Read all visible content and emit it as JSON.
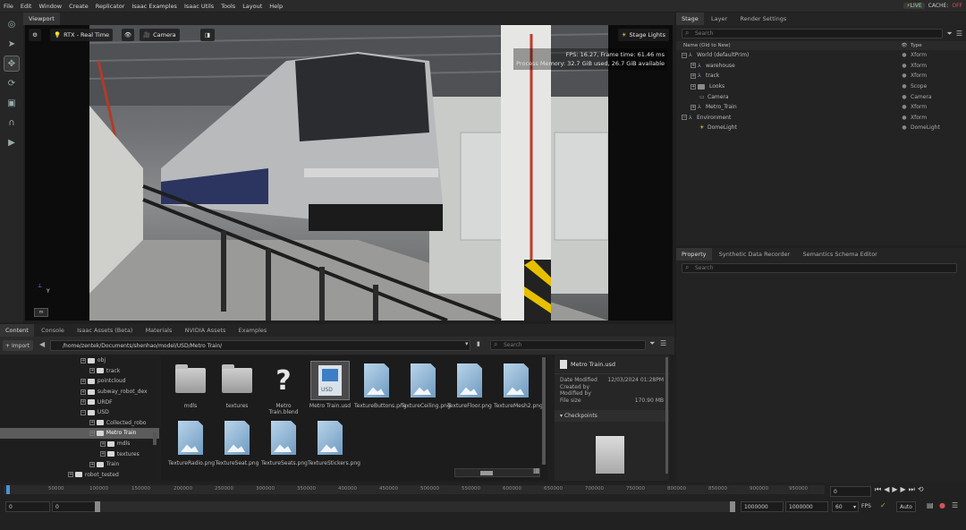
{
  "menubar": {
    "items": [
      "File",
      "Edit",
      "Window",
      "Create",
      "Replicator",
      "Isaac Examples",
      "Isaac Utils",
      "Tools",
      "Layout",
      "Help"
    ],
    "live_label": "LIVE",
    "cache_label": "CACHE:",
    "cache_state": "OFF"
  },
  "viewport": {
    "tab": "Viewport",
    "renderer": "RTX - Real Time",
    "camera": "Camera",
    "stage_lights": "Stage Lights",
    "fps_line": "FPS: 16.27, Frame time: 61.46 ms",
    "memory_line": "Process Memory: 32.7 GiB used, 26.7 GiB available",
    "axis_label": "Y"
  },
  "stage": {
    "tabs": [
      "Stage",
      "Layer",
      "Render Settings"
    ],
    "search_placeholder": "Search",
    "col_name": "Name (Old to New)",
    "col_type": "Type",
    "rows": [
      {
        "name": "World (defaultPrim)",
        "type": "Xform"
      },
      {
        "name": "warehouse",
        "type": "Xform"
      },
      {
        "name": "track",
        "type": "Xform"
      },
      {
        "name": "Looks",
        "type": "Scope"
      },
      {
        "name": "Camera",
        "type": "Camera"
      },
      {
        "name": "Metro_Train",
        "type": "Xform"
      },
      {
        "name": "Environment",
        "type": "Xform"
      },
      {
        "name": "DomeLight",
        "type": "DomeLight"
      }
    ]
  },
  "property": {
    "tabs": [
      "Property",
      "Synthetic Data Recorder",
      "Semantics Schema Editor"
    ],
    "search_placeholder": "Search"
  },
  "content": {
    "tabs": [
      "Content",
      "Console",
      "Isaac Assets (Beta)",
      "Materials",
      "NVIDIA Assets",
      "Examples"
    ],
    "import_label": "Import",
    "path": "/home/zentek/Documents/shenhao/model/USD/Metro Train/",
    "search_placeholder": "Search",
    "tree": [
      {
        "label": "obj"
      },
      {
        "label": "track"
      },
      {
        "label": "pointcloud"
      },
      {
        "label": "subway_robot_dex"
      },
      {
        "label": "URDF"
      },
      {
        "label": "USD"
      },
      {
        "label": "Collected_robo"
      },
      {
        "label": "Metro Train"
      },
      {
        "label": "mdls"
      },
      {
        "label": "textures"
      },
      {
        "label": "Train"
      },
      {
        "label": "robot_tested"
      }
    ],
    "grid": [
      {
        "label": "mdls"
      },
      {
        "label": "textures"
      },
      {
        "label": "Metro Train.blend"
      },
      {
        "label": "Metro Train.usd"
      },
      {
        "label": "TextureButtons.png"
      },
      {
        "label": "TextureCeiling.png"
      },
      {
        "label": "TextureFloor.png"
      },
      {
        "label": "TextureMesh2.png"
      },
      {
        "label": "TextureRadio.png"
      },
      {
        "label": "TextureSeat.png"
      },
      {
        "label": "TextureSeats.png"
      },
      {
        "label": "TextureStickers.png"
      }
    ],
    "details": {
      "file_name": "Metro Train.usd",
      "date_modified_label": "Date Modified",
      "date_modified": "12/03/2024 01:28PM",
      "created_by_label": "Created by",
      "modified_by_label": "Modified by",
      "file_size_label": "File size",
      "file_size": "170.90 MB",
      "checkpoints": "Checkpoints"
    }
  },
  "timeline": {
    "ticks": [
      "50000",
      "100000",
      "150000",
      "200000",
      "250000",
      "300000",
      "350000",
      "400000",
      "450000",
      "500000",
      "550000",
      "600000",
      "650000",
      "700000",
      "750000",
      "800000",
      "850000",
      "900000",
      "950000"
    ],
    "current_frame": "0",
    "start": "0",
    "start2": "0",
    "end": "1000000",
    "end2": "1000000",
    "fps_value": "60",
    "fps_label": "FPS",
    "auto_label": "Auto"
  }
}
